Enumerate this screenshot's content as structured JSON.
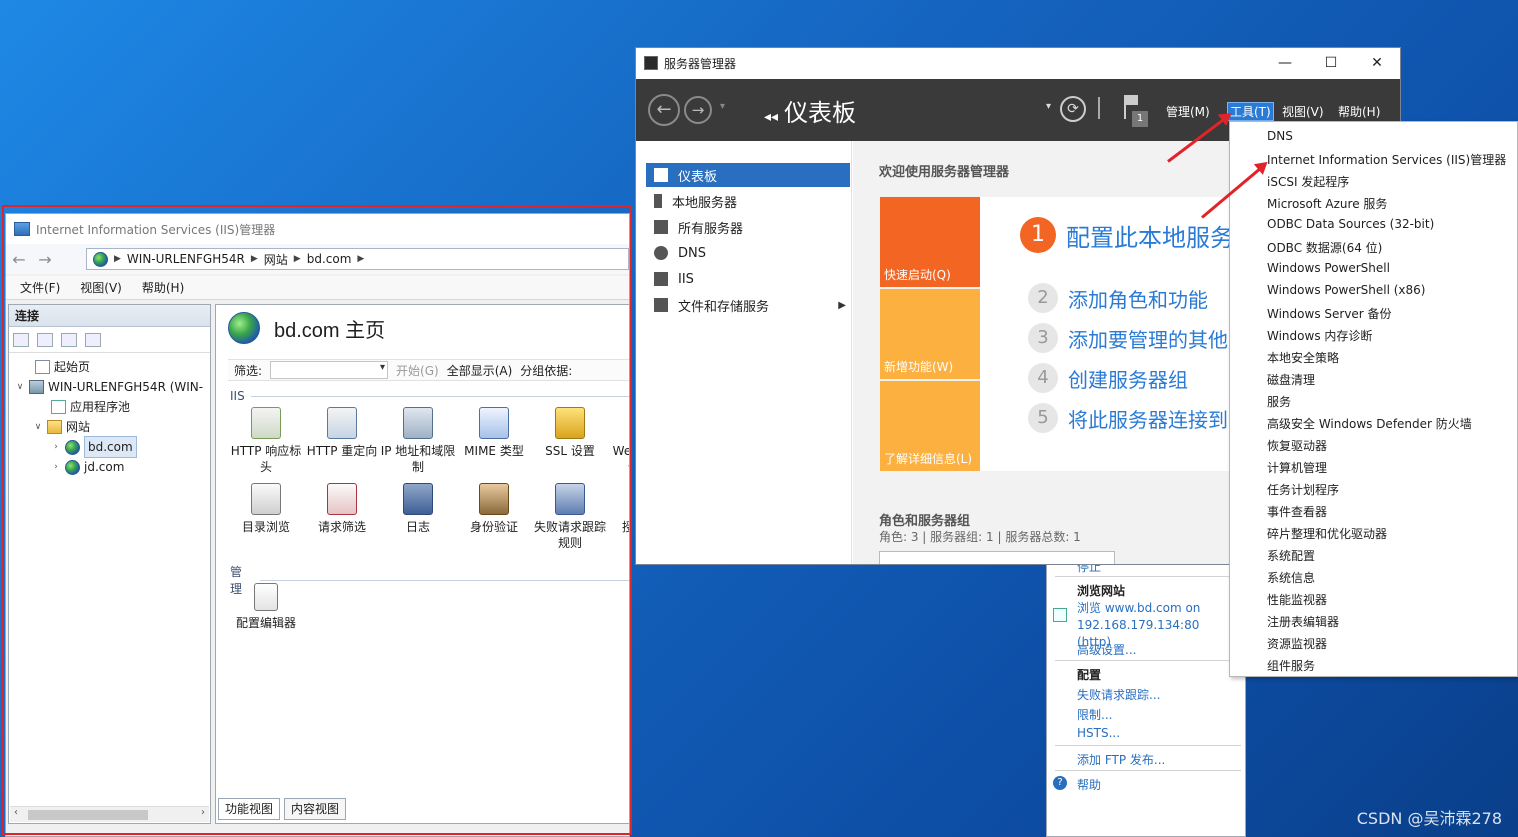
{
  "watermark": "CSDN @吴沛霖278",
  "iis": {
    "title": "Internet Information Services (IIS)管理器",
    "breadcrumb": [
      "WIN-URLENFGH54R",
      "网站",
      "bd.com"
    ],
    "menu": [
      "文件(F)",
      "视图(V)",
      "帮助(H)"
    ],
    "connections": {
      "header": "连接",
      "tree": {
        "start_page": "起始页",
        "server": "WIN-URLENFGH54R (WIN-",
        "app_pools": "应用程序池",
        "sites": "网站",
        "site1": "bd.com",
        "site2": "jd.com"
      }
    },
    "main": {
      "title": "bd.com 主页",
      "filter_label": "筛选:",
      "start_btn": "开始(G)",
      "show_all": "全部显示(A)",
      "group_by": "分组依据:",
      "group_iis": "IIS",
      "features": [
        "HTTP 响应标头",
        "HTTP 重定向",
        "IP 地址和域限制",
        "MIME 类型",
        "SSL 设置",
        "WebDAV 创作规则",
        "目录浏览",
        "请求筛选",
        "日志",
        "身份验证",
        "失败请求跟踪规则",
        "授权规则"
      ],
      "group_manage": "管理",
      "manage_features": [
        "配置编辑器"
      ]
    },
    "bottom_tabs": [
      "功能视图",
      "内容视图"
    ]
  },
  "actions": {
    "stop": "停止",
    "browse_header": "浏览网站",
    "browse_link": "浏览 www.bd.com on 192.168.179.134:80 (http)",
    "advanced": "高级设置...",
    "config_header": "配置",
    "failed_tracing": "失败请求跟踪...",
    "limits": "限制...",
    "hsts": "HSTS...",
    "add_ftp": "添加 FTP 发布...",
    "help": "帮助"
  },
  "server_manager": {
    "title": "服务器管理器",
    "breadcrumb": "仪表板",
    "menus": [
      "管理(M)",
      "工具(T)",
      "视图(V)",
      "帮助(H)"
    ],
    "flag_count": "1",
    "sidebar": [
      "仪表板",
      "本地服务器",
      "所有服务器",
      "DNS",
      "IIS",
      "文件和存储服务"
    ],
    "welcome": "欢迎使用服务器管理器",
    "tiles": [
      "快速启动(Q)",
      "新增功能(W)",
      "了解详细信息(L)"
    ],
    "steps": [
      {
        "n": "1",
        "label": "配置此本地服务器"
      },
      {
        "n": "2",
        "label": "添加角色和功能"
      },
      {
        "n": "3",
        "label": "添加要管理的其他服务器"
      },
      {
        "n": "4",
        "label": "创建服务器组"
      },
      {
        "n": "5",
        "label": "将此服务器连接到云服务"
      }
    ],
    "roles_title": "角色和服务器组",
    "roles_summary": "角色: 3 | 服务器组: 1 | 服务器总数: 1"
  },
  "tools_menu": [
    "DNS",
    "Internet Information Services (IIS)管理器",
    "iSCSI 发起程序",
    "Microsoft Azure 服务",
    "ODBC Data Sources (32-bit)",
    "ODBC 数据源(64 位)",
    "Windows PowerShell",
    "Windows PowerShell (x86)",
    "Windows Server 备份",
    "Windows 内存诊断",
    "本地安全策略",
    "磁盘清理",
    "服务",
    "高级安全 Windows Defender 防火墙",
    "恢复驱动器",
    "计算机管理",
    "任务计划程序",
    "事件查看器",
    "碎片整理和优化驱动器",
    "系统配置",
    "系统信息",
    "性能监视器",
    "注册表编辑器",
    "资源监视器",
    "组件服务"
  ],
  "colors": {
    "accent": "#2a7bd6",
    "annotation_red": "#e0242a",
    "tile_orange": "#f26522",
    "tile_amber": "#fbb040"
  }
}
